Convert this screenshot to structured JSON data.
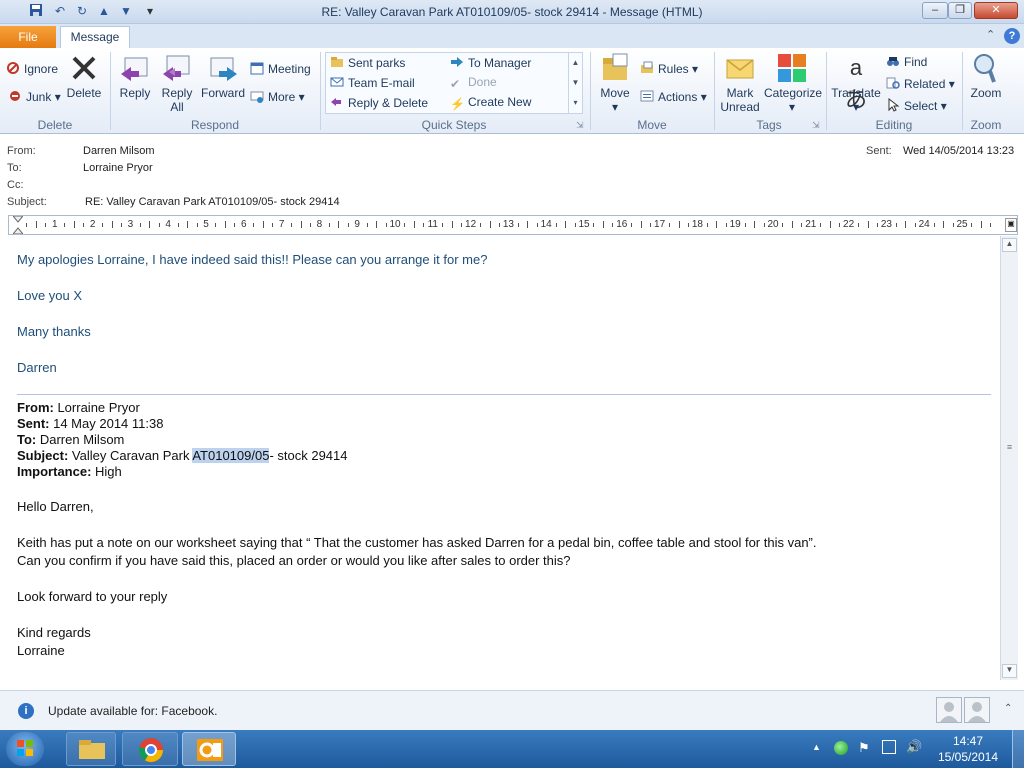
{
  "window": {
    "title": "RE: Valley Caravan Park AT010109/05- stock 29414  -  Message (HTML)"
  },
  "qat": {
    "save_icon": "save-icon",
    "undo_icon": "undo-icon",
    "redo_icon": "redo-icon",
    "up_icon": "up-arrow-icon",
    "down_icon": "down-arrow-icon"
  },
  "tabs": {
    "file": "File",
    "message": "Message"
  },
  "ribbon": {
    "delete_group": {
      "label": "Delete",
      "ignore": "Ignore",
      "junk": "Junk",
      "delete": "Delete"
    },
    "respond_group": {
      "label": "Respond",
      "reply": "Reply",
      "reply_all_1": "Reply",
      "reply_all_2": "All",
      "forward": "Forward",
      "meeting": "Meeting",
      "more": "More"
    },
    "quicksteps_group": {
      "label": "Quick Steps",
      "items": [
        "Sent parks",
        "To Manager",
        "Team E-mail",
        "Done",
        "Reply & Delete",
        "Create New"
      ]
    },
    "move_group": {
      "label": "Move",
      "move": "Move",
      "rules": "Rules",
      "actions": "Actions"
    },
    "tags_group": {
      "label": "Tags",
      "mark_1": "Mark",
      "mark_2": "Unread",
      "categorize": "Categorize"
    },
    "editing_group": {
      "label": "Editing",
      "translate": "Translate",
      "find": "Find",
      "related": "Related",
      "select": "Select"
    },
    "zoom_group": {
      "label": "Zoom",
      "zoom": "Zoom"
    }
  },
  "header": {
    "from_label": "From:",
    "from_value": "Darren Milsom",
    "to_label": "To:",
    "to_value": "Lorraine Pryor",
    "cc_label": "Cc:",
    "subject_label": "Subject:",
    "subject_value": "RE: Valley Caravan Park AT010109/05- stock 29414",
    "sent_label": "Sent:",
    "sent_value": "Wed 14/05/2014 13:23"
  },
  "ruler": {
    "ticks": [
      "1",
      "2",
      "3",
      "4",
      "5",
      "6",
      "7",
      "8",
      "9",
      "10",
      "11",
      "12",
      "13",
      "14",
      "15",
      "16",
      "17",
      "18",
      "19",
      "20",
      "21",
      "22",
      "23",
      "24",
      "25"
    ]
  },
  "reply": {
    "line1": "My apologies Lorraine, I have indeed said this!! Please can you arrange it for me?",
    "line2": "Love you X",
    "line3": "Many thanks",
    "line4": "Darren"
  },
  "original": {
    "from_label": "From:",
    "from_value": " Lorraine Pryor",
    "sent_label": "Sent:",
    "sent_value": " 14 May 2014 11:38",
    "to_label": "To:",
    "to_value": " Darren Milsom",
    "subject_label": "Subject:",
    "subject_pre": " Valley Caravan Park ",
    "subject_highlight": "AT010109/05",
    "subject_post": "- stock 29414",
    "importance_label": "Importance:",
    "importance_value": " High",
    "greeting": "Hello Darren,",
    "para1": "Keith has put a note on our worksheet saying that “ That the customer has asked Darren for a pedal bin, coffee table and stool for this van”.",
    "para2": "Can you confirm if you have said this, placed an order or would you like after sales to order this?",
    "closing1": "Look forward to your reply",
    "closing2": "Kind regards",
    "closing3": "Lorraine"
  },
  "infobar": {
    "text": "Update available for: Facebook."
  },
  "taskbar": {
    "time": "14:47",
    "date": "15/05/2014"
  }
}
